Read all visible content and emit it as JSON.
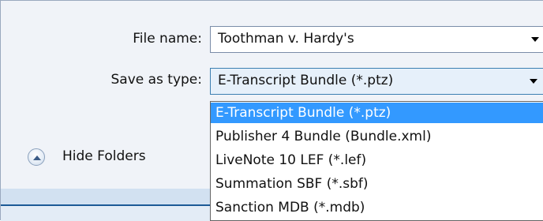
{
  "form": {
    "file_name_label": "File name:",
    "file_name_value": "Toothman v. Hardy's",
    "save_type_label": "Save as type:",
    "save_type_value": "E-Transcript Bundle (*.ptz)"
  },
  "dropdown": {
    "options": [
      "E-Transcript Bundle (*.ptz)",
      "Publisher 4 Bundle (Bundle.xml)",
      "LiveNote 10 LEF (*.lef)",
      "Summation SBF (*.sbf)",
      "Sanction MDB (*.mdb)"
    ],
    "selected_index": 0
  },
  "folders": {
    "hide_label": "Hide Folders",
    "icon": "chevron-up-circle-icon"
  },
  "colors": {
    "selection": "#3399ff",
    "dialog_bg": "#f0f3f8"
  }
}
